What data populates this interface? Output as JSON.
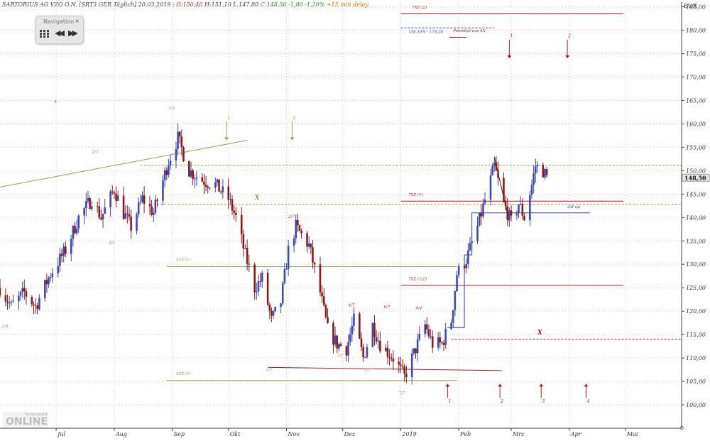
{
  "header": {
    "instrument": "SARTORIUS AG VZO O.N. [SRT3 GER Täglich] 20.03.2019 :",
    "open": "O:150,40",
    "high": "H:151,10",
    "low": "L:147,80",
    "close": "C:148,50 -1,80 -1,20%",
    "delay": "+15 min delay"
  },
  "navigation": {
    "title": "Navigation",
    "close": "×",
    "back": "◀◀",
    "forward": "▶▶"
  },
  "logo": {
    "small": "Tradesignal®",
    "big": "ONLINE"
  },
  "zoom_indicator": "⊘",
  "colors": {
    "up": "#3c4ab2",
    "down": "#8b1a1a",
    "olive": "#9a9a55",
    "red": "#a31f1f",
    "blue": "#2b3fc9",
    "grid": "#cfcfcf",
    "axis": "#444444"
  },
  "chart_data": {
    "type": "candlestick",
    "currency": "EUR",
    "last_price_label": "148,50",
    "last_price": 148.5,
    "ylim": [
      95,
      186
    ],
    "y_ticks": [
      100,
      105,
      110,
      115,
      120,
      125,
      130,
      135,
      140,
      145,
      150,
      155,
      160,
      165,
      170,
      175,
      180,
      185
    ],
    "y_tick_labels": [
      "100,00",
      "105,00",
      "110,00",
      "115,00",
      "120,00",
      "125,00",
      "130,00",
      "135,00",
      "140,00",
      "145,00",
      "150,00",
      "155,00",
      "160,00",
      "165,00",
      "170,00",
      "175,00",
      "180,00",
      "185,00"
    ],
    "x_range": [
      "2018-06-01",
      "2019-05-31"
    ],
    "x_ticks": [
      {
        "date": "2018-07-01",
        "label": "Jul"
      },
      {
        "date": "2018-08-01",
        "label": "Aug"
      },
      {
        "date": "2018-09-01",
        "label": "Sep"
      },
      {
        "date": "2018-10-01",
        "label": "Okt"
      },
      {
        "date": "2018-11-01",
        "label": "Nov"
      },
      {
        "date": "2018-12-01",
        "label": "Dez"
      },
      {
        "date": "2019-01-01",
        "label": "2019"
      },
      {
        "date": "2019-02-01",
        "label": "Feb"
      },
      {
        "date": "2019-03-01",
        "label": "Mrz"
      },
      {
        "date": "2019-04-01",
        "label": "Apr"
      },
      {
        "date": "2019-05-01",
        "label": "Mai"
      }
    ],
    "grid": true,
    "series_anchors": [
      [
        "2018-06-01",
        125
      ],
      [
        "2018-06-07",
        121
      ],
      [
        "2018-06-14",
        124
      ],
      [
        "2018-06-20",
        121
      ],
      [
        "2018-06-28",
        128
      ],
      [
        "2018-07-06",
        133
      ],
      [
        "2018-07-13",
        140
      ],
      [
        "2018-07-20",
        144
      ],
      [
        "2018-07-25",
        140
      ],
      [
        "2018-08-01",
        146
      ],
      [
        "2018-08-06",
        141
      ],
      [
        "2018-08-10",
        138
      ],
      [
        "2018-08-16",
        144
      ],
      [
        "2018-08-22",
        141
      ],
      [
        "2018-08-30",
        152
      ],
      [
        "2018-09-04",
        157
      ],
      [
        "2018-09-10",
        150
      ],
      [
        "2018-09-17",
        148
      ],
      [
        "2018-09-24",
        147
      ],
      [
        "2018-10-01",
        144
      ],
      [
        "2018-10-05",
        140
      ],
      [
        "2018-10-10",
        132
      ],
      [
        "2018-10-15",
        125
      ],
      [
        "2018-10-19",
        127
      ],
      [
        "2018-10-24",
        118
      ],
      [
        "2018-10-29",
        122
      ],
      [
        "2018-11-02",
        133
      ],
      [
        "2018-11-06",
        138
      ],
      [
        "2018-11-13",
        134
      ],
      [
        "2018-11-19",
        124
      ],
      [
        "2018-11-23",
        116
      ],
      [
        "2018-11-28",
        113
      ],
      [
        "2018-12-03",
        112
      ],
      [
        "2018-12-07",
        118
      ],
      [
        "2018-12-12",
        110
      ],
      [
        "2018-12-17",
        117
      ],
      [
        "2018-12-21",
        113
      ],
      [
        "2018-12-28",
        110
      ],
      [
        "2019-01-03",
        106
      ],
      [
        "2019-01-09",
        112
      ],
      [
        "2019-01-14",
        117
      ],
      [
        "2019-01-18",
        113
      ],
      [
        "2019-01-23",
        113
      ],
      [
        "2019-01-28",
        118
      ],
      [
        "2019-01-31",
        128
      ],
      [
        "2019-02-05",
        131
      ],
      [
        "2019-02-11",
        138
      ],
      [
        "2019-02-18",
        148
      ],
      [
        "2019-02-20",
        151
      ],
      [
        "2019-02-25",
        143
      ],
      [
        "2019-03-01",
        139
      ],
      [
        "2019-03-05",
        143
      ],
      [
        "2019-03-08",
        140
      ],
      [
        "2019-03-12",
        147
      ],
      [
        "2019-03-14",
        151
      ],
      [
        "2019-03-18",
        150
      ],
      [
        "2019-03-20",
        148.5
      ]
    ],
    "drawings": {
      "olive_trendline": {
        "from": [
          "2018-06-01",
          146.5
        ],
        "to": [
          "2018-10-11",
          156.5
        ]
      },
      "hlines": [
        {
          "name": "olive-dashed",
          "y": 151.2,
          "from": "2018-08-15",
          "to": "2019-05-31",
          "style": "dashed",
          "color": "olive"
        },
        {
          "name": "olive-dashed-x",
          "y": 142.8,
          "from": "2018-08-20",
          "to": "2019-05-31",
          "style": "dashed",
          "color": "olive"
        },
        {
          "name": "olive-5xz-1",
          "y": 129.5,
          "from": "2018-08-29",
          "to": "2019-01-31",
          "style": "solid",
          "color": "olive"
        },
        {
          "name": "olive-5xz-2",
          "y": 105.2,
          "from": "2018-08-29",
          "to": "2019-01-31",
          "style": "solid",
          "color": "olive"
        },
        {
          "name": "red-7xz-2",
          "y": 183.5,
          "from": "2019-01-01",
          "to": "2019-04-30",
          "style": "solid",
          "color": "red"
        },
        {
          "name": "red-7xz-1",
          "y": 143.5,
          "from": "2019-01-01",
          "to": "2019-04-30",
          "style": "solid",
          "color": "red"
        },
        {
          "name": "red-7xz-1-2",
          "y": 125.5,
          "from": "2019-01-01",
          "to": "2019-04-30",
          "style": "solid",
          "color": "red"
        },
        {
          "name": "red-dashed-x",
          "y": 114.0,
          "from": "2019-01-28",
          "to": "2019-05-31",
          "style": "dashed",
          "color": "red"
        },
        {
          "name": "blue-dashed",
          "y": 180.5,
          "from": "2019-01-01",
          "to": "2019-02-20",
          "style": "dashed",
          "color": "blue"
        },
        {
          "name": "red-short",
          "y": 178.5,
          "from": "2019-01-27",
          "to": "2019-02-05",
          "style": "solid",
          "color": "red"
        },
        {
          "name": "blue-2-8-up",
          "y": 141.0,
          "from": "2019-02-20",
          "to": "2019-04-12",
          "style": "solid",
          "color": "blue"
        }
      ],
      "red_sloped": {
        "from": [
          "2018-10-22",
          108.0
        ],
        "to": [
          "2019-02-24",
          107.3
        ]
      },
      "blue_step": [
        [
          "2019-01-26",
          116.5
        ],
        [
          "2019-02-04",
          116.5
        ],
        [
          "2019-02-04",
          132.0
        ],
        [
          "2019-02-08",
          132.0
        ],
        [
          "2019-02-08",
          141.0
        ],
        [
          "2019-02-20",
          141.0
        ]
      ],
      "black_connector": {
        "from": [
          "2019-02-20",
          153
        ],
        "to": [
          "2019-02-28",
          139
        ]
      }
    },
    "labels": [
      {
        "text": "5XZ (1)",
        "x": "2018-09-03",
        "y": 130.7,
        "color": "olive"
      },
      {
        "text": "5XZ (2)",
        "x": "2018-09-03",
        "y": 106.4,
        "color": "olive"
      },
      {
        "text": "X",
        "x": "2018-10-15",
        "y": 143.8,
        "color": "olive"
      },
      {
        "text": "7XZ (2)",
        "x": "2019-01-07",
        "y": 184.6,
        "color": "red"
      },
      {
        "text": "7XZ (1)",
        "x": "2019-01-05",
        "y": 144.6,
        "color": "red"
      },
      {
        "text": "7XZ (1/2)",
        "x": "2019-01-05",
        "y": 126.6,
        "color": "red"
      },
      {
        "text": "X",
        "x": "2019-03-15",
        "y": 115.0,
        "color": "red"
      },
      {
        "text": "158,30% - 178,28",
        "x": "2019-01-05",
        "y": 179.4,
        "color": "blue"
      },
      {
        "text": "Potential aus 4X",
        "x": "2019-01-29",
        "y": 179.6,
        "color": "red"
      },
      {
        "text": "2/8 up",
        "x": "2019-03-31",
        "y": 142.0,
        "color": "blue"
      },
      {
        "text": "2/3",
        "x": "2018-06-02",
        "y": 116.5,
        "color": "olive"
      },
      {
        "text": "2/3",
        "x": "2018-07-20",
        "y": 153.8,
        "color": "olive"
      },
      {
        "text": "4/3",
        "x": "2018-07-29",
        "y": 134.3,
        "color": "olive"
      },
      {
        "text": "5/3",
        "x": "2018-08-30",
        "y": 163.1,
        "color": "olive"
      },
      {
        "text": "1/7",
        "x": "2018-10-21",
        "y": 107.1,
        "color": "olive"
      },
      {
        "text": "2/7",
        "x": "2018-11-02",
        "y": 140.0,
        "color": "red"
      },
      {
        "text": "3/7",
        "x": "2018-11-28",
        "y": 110.3,
        "color": "olive"
      },
      {
        "text": "4/7",
        "x": "2018-12-04",
        "y": 121.0,
        "color": "red"
      },
      {
        "text": "5/7",
        "x": "2018-12-13",
        "y": 107.1,
        "color": "olive"
      },
      {
        "text": "6/7",
        "x": "2018-12-23",
        "y": 120.6,
        "color": "red"
      },
      {
        "text": "7/7",
        "x": "2018-12-31",
        "y": 102.3,
        "color": "olive"
      },
      {
        "text": "8/4",
        "x": "2019-01-09",
        "y": 120.4,
        "color": "red"
      },
      {
        "text": "1",
        "x": "2018-06-30",
        "y": 164.5,
        "color": "olive"
      },
      {
        "text": "2",
        "x": "2018-06-30",
        "y": 164.5,
        "color": "olive"
      }
    ],
    "arrows": [
      {
        "dir": "down",
        "x": "2018-09-30",
        "y_top": 160.5,
        "y_tip": 156.5,
        "color": "olive",
        "label": "1"
      },
      {
        "dir": "down",
        "x": "2018-11-04",
        "y_top": 160.5,
        "y_tip": 156.5,
        "color": "olive",
        "label": "2"
      },
      {
        "dir": "down",
        "x": "2019-02-28",
        "y_top": 178.0,
        "y_tip": 174.0,
        "color": "red",
        "label": "1"
      },
      {
        "dir": "down",
        "x": "2019-03-31",
        "y_top": 178.0,
        "y_tip": 174.0,
        "color": "red",
        "label": "2"
      },
      {
        "dir": "up",
        "x": "2019-01-26",
        "y_bottom": 101.5,
        "y_tip": 104.5,
        "color": "red",
        "label": "1"
      },
      {
        "dir": "up",
        "x": "2019-02-23",
        "y_bottom": 101.5,
        "y_tip": 104.5,
        "color": "red",
        "label": "2"
      },
      {
        "dir": "up",
        "x": "2019-03-17",
        "y_bottom": 101.5,
        "y_tip": 104.5,
        "color": "red",
        "label": "3"
      },
      {
        "dir": "up",
        "x": "2019-04-10",
        "y_bottom": 101.5,
        "y_tip": 104.5,
        "color": "red",
        "label": "4"
      }
    ]
  }
}
